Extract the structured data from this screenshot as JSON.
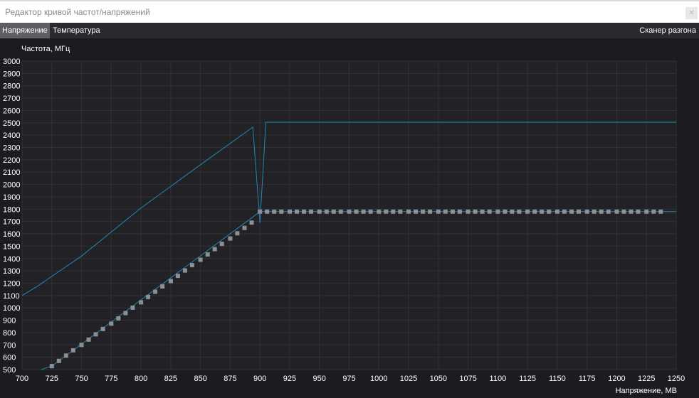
{
  "window": {
    "title": "Редактор кривой частот/напряжений",
    "close_icon": "close-icon"
  },
  "tabs": [
    {
      "label": "Напряжение",
      "active": true
    },
    {
      "label": "Температура",
      "active": false
    }
  ],
  "scanner_label": "Сканер разгона",
  "colors": {
    "background": "#1c1c20",
    "grid": "#303036",
    "curve_line": "#1e88b4",
    "points": "#8c8f94"
  },
  "chart_data": {
    "type": "line",
    "xlabel": "Напряжение, МВ",
    "ylabel": "Частота, МГц",
    "xlim": [
      700,
      1250
    ],
    "ylim": [
      500,
      3000
    ],
    "x_ticks": [
      "700",
      "725",
      "750",
      "775",
      "800",
      "825",
      "850",
      "875",
      "900",
      "925",
      "950",
      "975",
      "1000",
      "1025",
      "1050",
      "1075",
      "1100",
      "1125",
      "1150",
      "1175",
      "1200",
      "1225",
      "1250"
    ],
    "y_ticks": [
      "3000",
      "2900",
      "2800",
      "2700",
      "2600",
      "2500",
      "2400",
      "2300",
      "2200",
      "2100",
      "2000",
      "1900",
      "1800",
      "1700",
      "1600",
      "1500",
      "1400",
      "1300",
      "1200",
      "1100",
      "1000",
      "900",
      "800",
      "700",
      "600",
      "500"
    ],
    "grid": true,
    "series": [
      {
        "kind": "line",
        "x": [
          700,
          712,
          750,
          800,
          850,
          894,
          900,
          905,
          1250
        ],
        "y": [
          1100,
          1170,
          1420,
          1810,
          2160,
          2465,
          1690,
          2505,
          2505
        ]
      },
      {
        "kind": "line",
        "x": [
          716,
          725,
          900,
          1250
        ],
        "y": [
          500,
          528,
          1780,
          1780
        ]
      },
      {
        "kind": "points",
        "x": [
          725,
          731,
          737,
          743,
          750,
          756,
          762,
          768,
          775,
          781,
          787,
          793,
          800,
          806,
          812,
          818,
          825,
          831,
          837,
          843,
          850,
          856,
          862,
          868,
          875,
          881,
          887,
          893,
          900,
          906,
          912,
          918,
          925,
          931,
          937,
          943,
          950,
          956,
          962,
          968,
          975,
          981,
          987,
          993,
          1000,
          1006,
          1012,
          1018,
          1025,
          1031,
          1037,
          1043,
          1050,
          1056,
          1062,
          1068,
          1075,
          1081,
          1087,
          1093,
          1100,
          1106,
          1112,
          1118,
          1125,
          1131,
          1137,
          1143,
          1150,
          1156,
          1162,
          1168,
          1175,
          1181,
          1187,
          1193,
          1200,
          1206,
          1212,
          1218,
          1225,
          1231,
          1237
        ],
        "y": [
          528,
          570,
          613,
          656,
          700,
          743,
          786,
          829,
          872,
          915,
          958,
          1002,
          1045,
          1088,
          1131,
          1174,
          1217,
          1260,
          1303,
          1346,
          1390,
          1433,
          1476,
          1519,
          1562,
          1605,
          1648,
          1691,
          1780,
          1780,
          1780,
          1780,
          1780,
          1780,
          1780,
          1780,
          1780,
          1780,
          1780,
          1780,
          1780,
          1780,
          1780,
          1780,
          1780,
          1780,
          1780,
          1780,
          1780,
          1780,
          1780,
          1780,
          1780,
          1780,
          1780,
          1780,
          1780,
          1780,
          1780,
          1780,
          1780,
          1780,
          1780,
          1780,
          1780,
          1780,
          1780,
          1780,
          1780,
          1780,
          1780,
          1780,
          1780,
          1780,
          1780,
          1780,
          1780,
          1780,
          1780,
          1780,
          1780,
          1780,
          1780
        ]
      }
    ]
  }
}
